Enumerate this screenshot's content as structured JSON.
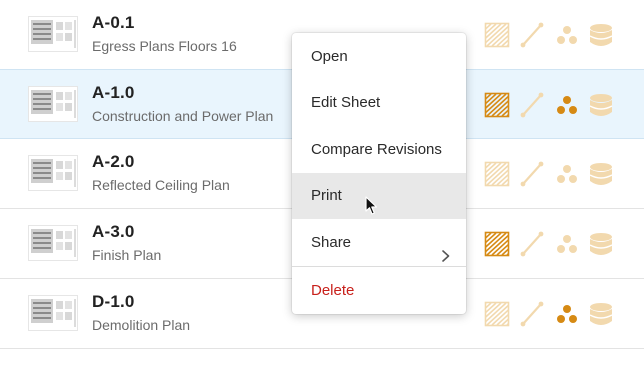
{
  "colors": {
    "accent": "#d68a14",
    "accent_faded": "#f2d9ae",
    "selected_row": "#e9f5fd",
    "danger": "#c8201b",
    "hover": "#e8e8e8"
  },
  "sheets": [
    {
      "number": "A-0.1",
      "title": "Egress Plans Floors 16",
      "selected": false,
      "hatch_active": false,
      "dots_active": false
    },
    {
      "number": "A-1.0",
      "title": "Construction and Power Plan",
      "selected": true,
      "hatch_active": true,
      "dots_active": true
    },
    {
      "number": "A-2.0",
      "title": "Reflected Ceiling Plan",
      "selected": false,
      "hatch_active": false,
      "dots_active": false
    },
    {
      "number": "A-3.0",
      "title": "Finish Plan",
      "selected": false,
      "hatch_active": true,
      "dots_active": false
    },
    {
      "number": "D-1.0",
      "title": "Demolition Plan",
      "selected": false,
      "hatch_active": false,
      "dots_active": true
    }
  ],
  "context_menu": {
    "items": [
      {
        "label": "Open",
        "hover": false,
        "submenu": false,
        "danger": false
      },
      {
        "label": "Edit Sheet",
        "hover": false,
        "submenu": false,
        "danger": false
      },
      {
        "label": "Compare Revisions",
        "hover": false,
        "submenu": false,
        "danger": false
      },
      {
        "label": "Print",
        "hover": true,
        "submenu": false,
        "danger": false
      },
      {
        "label": "Share",
        "hover": false,
        "submenu": true,
        "danger": false
      },
      {
        "label": "Delete",
        "hover": false,
        "submenu": false,
        "danger": true
      }
    ]
  },
  "icons": {
    "row_icons": [
      "hatch-icon",
      "ruler-icon",
      "dots-icon",
      "database-icon"
    ],
    "submenu": "chevron-right-icon",
    "cursor": "mouse-pointer-icon"
  }
}
